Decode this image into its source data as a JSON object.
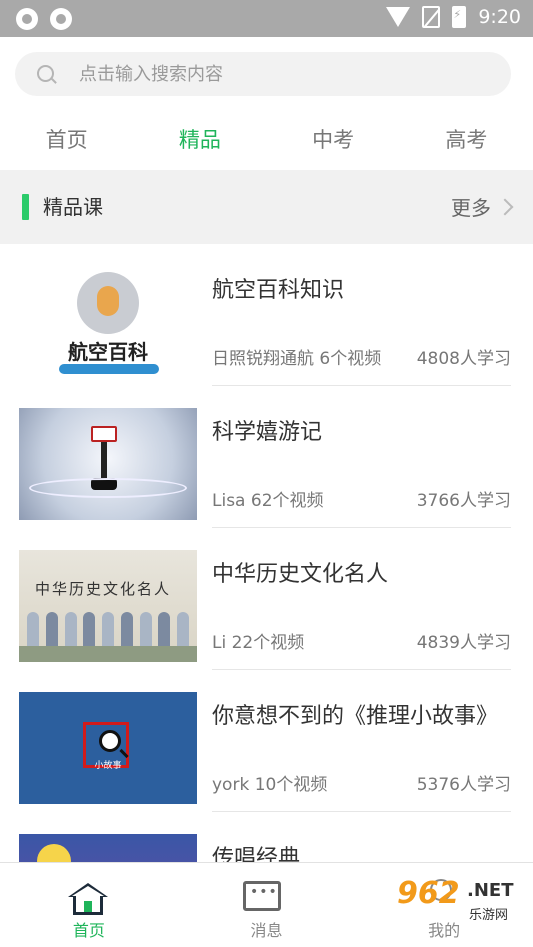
{
  "status_bar": {
    "time": "9:20"
  },
  "search": {
    "placeholder": "点击输入搜索内容"
  },
  "tabs": [
    {
      "label": "首页",
      "active": false
    },
    {
      "label": "精品",
      "active": true
    },
    {
      "label": "中考",
      "active": false
    },
    {
      "label": "高考",
      "active": false
    }
  ],
  "section": {
    "title": "精品课",
    "more_label": "更多"
  },
  "thumb_text": {
    "aviation": "航空百科",
    "history": "中华历史文化名人",
    "mystery": "小故事"
  },
  "courses": [
    {
      "title": "航空百科知识",
      "author": "日照锐翔通航   6个视频",
      "learners": "4808人学习"
    },
    {
      "title": "科学嬉游记",
      "author": "Lisa   62个视频",
      "learners": "3766人学习"
    },
    {
      "title": "中华历史文化名人",
      "author": "Li   22个视频",
      "learners": "4839人学习"
    },
    {
      "title": "你意想不到的《推理小故事》",
      "author": "york   10个视频",
      "learners": "5376人学习"
    },
    {
      "title": "传唱经典",
      "author": "",
      "learners": ""
    }
  ],
  "bottom_nav": {
    "home_label": "首页",
    "message_label": "消息",
    "profile_label": "我的"
  },
  "watermark": {
    "logo": "962",
    "net": ".NET",
    "sub": "乐游网"
  },
  "colors": {
    "accent": "#1fb45a",
    "section_bar": "#2bcb6a",
    "status_bar": "#a9a9a9"
  }
}
